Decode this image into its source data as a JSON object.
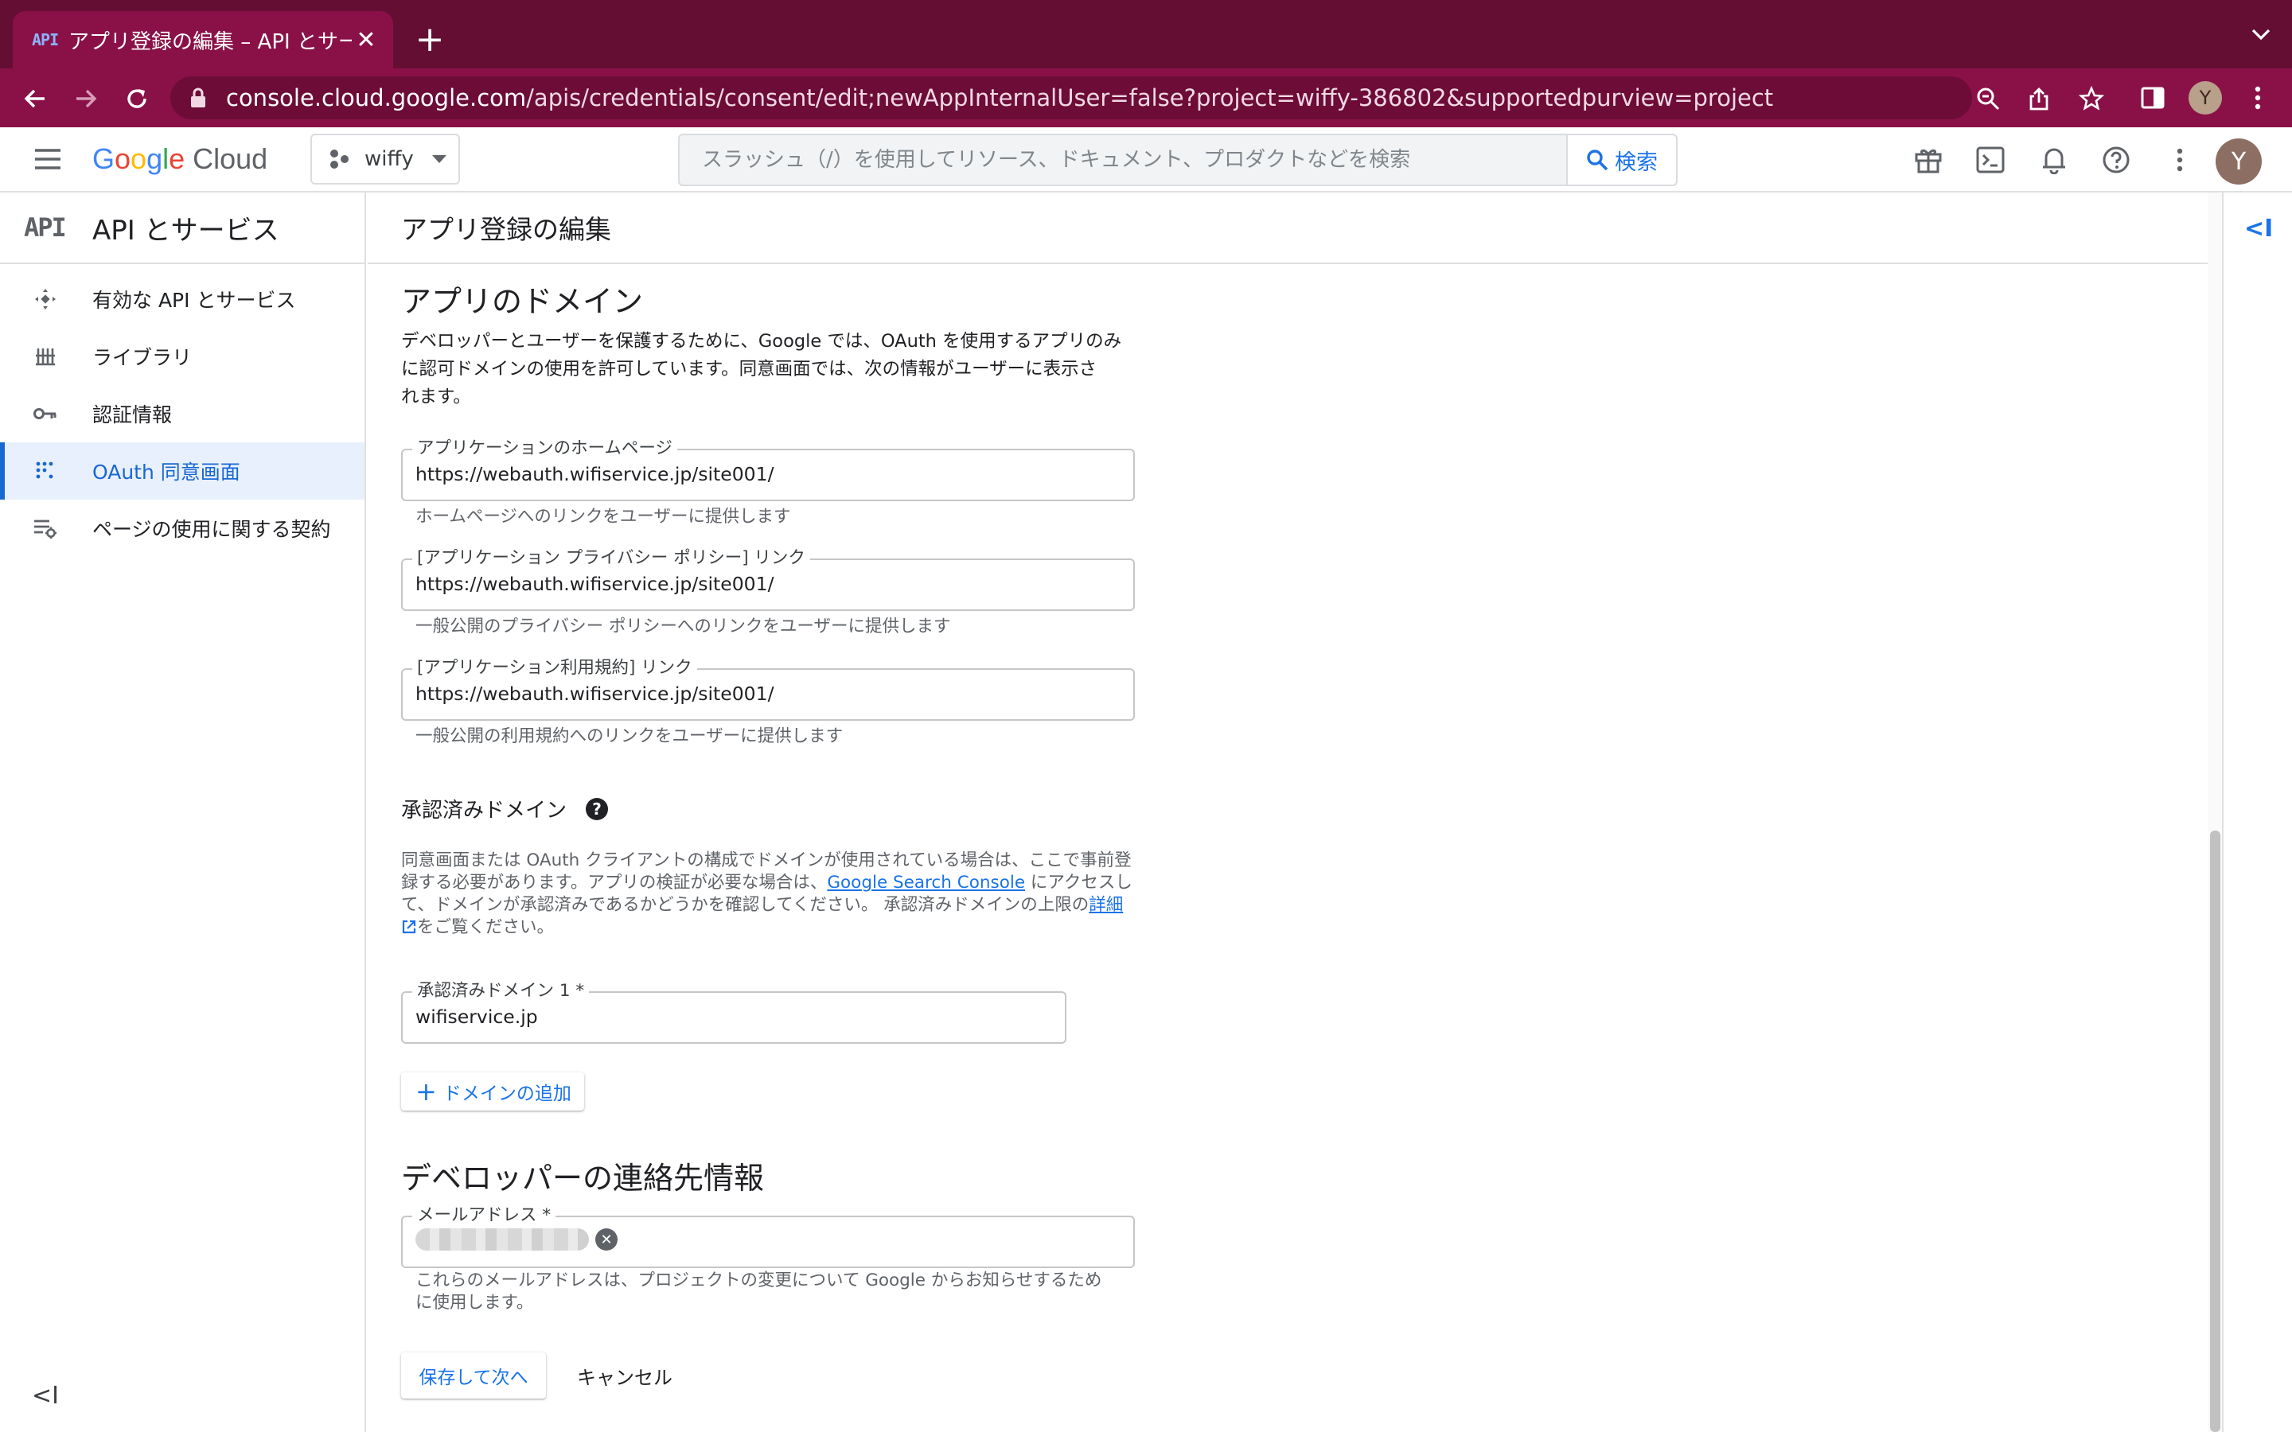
{
  "browser": {
    "tab_icon_text": "API",
    "tab_title": "アプリ登録の編集 – API とサービス",
    "tab_close": "✕",
    "new_tab": "+",
    "url_host": "console.cloud.google.com",
    "url_path": "/apis/credentials/consent/edit;newAppInternalUser=false?project=wiffy-386802&supportedpurview=project",
    "profile_initial": "Y"
  },
  "header": {
    "logo_word": "Google",
    "logo_product": "Cloud",
    "project_name": "wiffy",
    "search_placeholder": "スラッシュ（/）を使用してリソース、ドキュメント、プロダクトなどを検索",
    "search_button": "検索",
    "user_initial": "Y"
  },
  "sidebar": {
    "logo_text": "API",
    "title": "API とサービス",
    "items": [
      {
        "label": "有効な API とサービス",
        "icon": "api-diamond-icon"
      },
      {
        "label": "ライブラリ",
        "icon": "library-icon"
      },
      {
        "label": "認証情報",
        "icon": "key-icon"
      },
      {
        "label": "OAuth 同意画面",
        "icon": "consent-dots-icon",
        "active": true
      },
      {
        "label": "ページの使用に関する契約",
        "icon": "settings-list-icon"
      }
    ],
    "collapse": "<I"
  },
  "page": {
    "title": "アプリ登録の編集",
    "domain_section": {
      "title": "アプリのドメイン",
      "desc_line1": "デベロッパーとユーザーを保護するために、Google では、OAuth を使用するアプリのみ",
      "desc_line2": "に認可ドメインの使用を許可しています。同意画面では、次の情報がユーザーに表示さ",
      "desc_line3": "れます。",
      "homepage": {
        "label": "アプリケーションのホームページ",
        "value": "https://webauth.wifiservice.jp/site001/",
        "hint": "ホームページへのリンクをユーザーに提供します"
      },
      "privacy": {
        "label": "[アプリケーション プライバシー ポリシー] リンク",
        "value": "https://webauth.wifiservice.jp/site001/",
        "hint": "一般公開のプライバシー ポリシーへのリンクをユーザーに提供します"
      },
      "terms": {
        "label": "[アプリケーション利用規約] リンク",
        "value": "https://webauth.wifiservice.jp/site001/",
        "hint": "一般公開の利用規約へのリンクをユーザーに提供します"
      }
    },
    "authorized": {
      "title": "承認済みドメイン",
      "help_icon": "?",
      "desc_line1": "同意画面または OAuth クライアントの構成でドメインが使用されている場合は、ここで事前登",
      "desc_line2a": "録する必要があります。アプリの検証が必要な場合は、",
      "link_search_console": "Google Search Console",
      "desc_line2b": " にアクセスし",
      "desc_line3a": "て、ドメインが承認済みであるかどうかを確認してください。 承認済みドメインの上限の",
      "link_details": "詳細",
      "desc_line4": "をご覧ください。",
      "domain1_label": "承認済みドメイン 1 *",
      "domain1_value": "wifiservice.jp",
      "add_button": "ドメインの追加",
      "add_plus": "+"
    },
    "contact": {
      "title": "デベロッパーの連絡先情報",
      "email_label": "メールアドレス *",
      "chip_clear": "✕",
      "hint_line1": "これらのメールアドレスは、プロジェクトの変更について Google からお知らせするため",
      "hint_line2": "に使用します。"
    },
    "save_button": "保存して次へ",
    "cancel_button": "キャンセル"
  },
  "right_rail": {
    "toggle": "<I"
  },
  "colors": {
    "browser_frame": "#640e33",
    "browser_toolbar": "#8a1148",
    "accent_blue": "#1a73e8",
    "active_bg": "#e8f0fe"
  }
}
